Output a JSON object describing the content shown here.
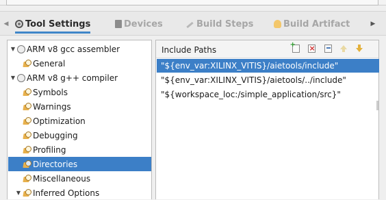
{
  "tabs": [
    {
      "label": "Tool Settings",
      "icon": "gear-icon",
      "active": true
    },
    {
      "label": "Devices",
      "icon": "device-icon",
      "active": false
    },
    {
      "label": "Build Steps",
      "icon": "wrench-icon",
      "active": false
    },
    {
      "label": "Build Artifact",
      "icon": "lightbulb-icon",
      "active": false
    }
  ],
  "tree": {
    "items": [
      {
        "label": "ARM v8 gcc assembler",
        "level": 0,
        "expanded": true,
        "icon": "tool-icon"
      },
      {
        "label": "General",
        "level": 1,
        "icon": "settings-icon"
      },
      {
        "label": "ARM v8 g++ compiler",
        "level": 0,
        "expanded": true,
        "icon": "tool-icon"
      },
      {
        "label": "Symbols",
        "level": 1,
        "icon": "settings-icon"
      },
      {
        "label": "Warnings",
        "level": 1,
        "icon": "settings-icon"
      },
      {
        "label": "Optimization",
        "level": 1,
        "icon": "settings-icon"
      },
      {
        "label": "Debugging",
        "level": 1,
        "icon": "settings-icon"
      },
      {
        "label": "Profiling",
        "level": 1,
        "icon": "settings-icon"
      },
      {
        "label": "Directories",
        "level": 1,
        "icon": "settings-icon",
        "selected": true
      },
      {
        "label": "Miscellaneous",
        "level": 1,
        "icon": "settings-icon"
      },
      {
        "label": "Inferred Options",
        "level": 1,
        "expanded": true,
        "icon": "settings-icon"
      }
    ]
  },
  "include_paths": {
    "title": "Include Paths",
    "toolbar": [
      "add-icon",
      "delete-icon",
      "edit-icon",
      "move-up-icon",
      "move-down-icon"
    ],
    "items": [
      {
        "value": "\"${env_var:XILINX_VITIS}/aietools/include\"",
        "selected": true
      },
      {
        "value": "\"${env_var:XILINX_VITIS}/aietools/../include\"",
        "selected": false
      },
      {
        "value": "\"${workspace_loc:/simple_application/src}\"",
        "selected": false
      }
    ]
  },
  "colors": {
    "selection": "#3c7fc7",
    "active_tab_underline": "#3f86c8",
    "inactive_tab_text": "#a6a6a6"
  }
}
